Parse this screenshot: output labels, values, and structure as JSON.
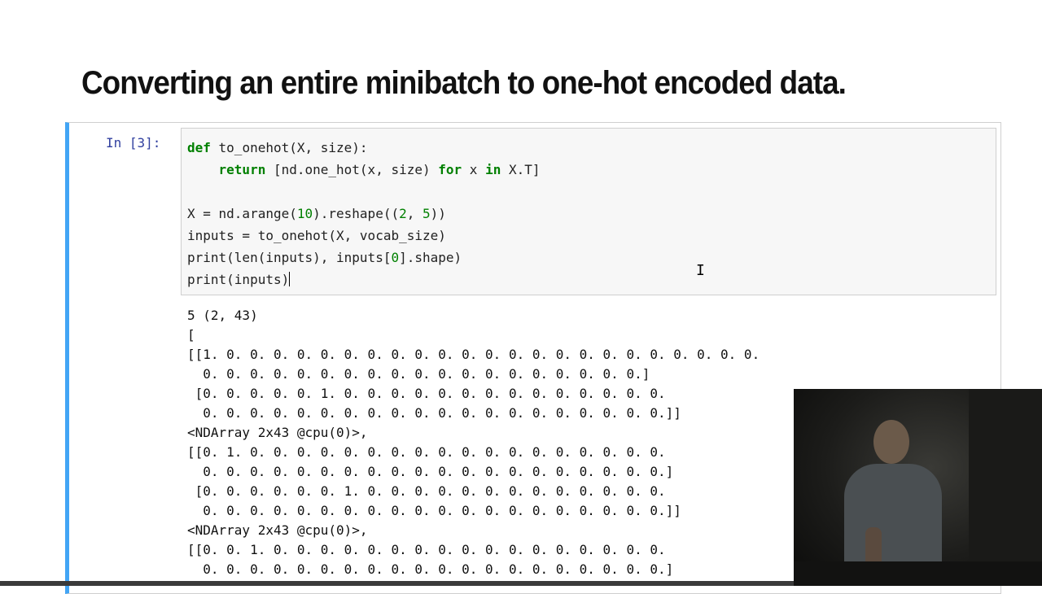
{
  "slide": {
    "heading": "Converting an entire minibatch to one-hot encoded data."
  },
  "cell": {
    "prompt": "In [3]:",
    "code_lines": [
      "def to_onehot(X, size):",
      "    return [nd.one_hot(x, size) for x in X.T]",
      "",
      "X = nd.arange(10).reshape((2, 5))",
      "inputs = to_onehot(X, vocab_size)",
      "print(len(inputs), inputs[0].shape)",
      "print(inputs)"
    ],
    "output_lines": [
      "5 (2, 43)",
      "[",
      "[[1. 0. 0. 0. 0. 0. 0. 0. 0. 0. 0. 0. 0. 0. 0. 0. 0. 0. 0. 0. 0. 0. 0. 0.",
      "  0. 0. 0. 0. 0. 0. 0. 0. 0. 0. 0. 0. 0. 0. 0. 0. 0. 0. 0.]",
      " [0. 0. 0. 0. 0. 1. 0. 0. 0. 0. 0. 0. 0. 0. 0. 0. 0. 0. 0. 0.",
      "  0. 0. 0. 0. 0. 0. 0. 0. 0. 0. 0. 0. 0. 0. 0. 0. 0. 0. 0. 0.]]",
      "<NDArray 2x43 @cpu(0)>,",
      "[[0. 1. 0. 0. 0. 0. 0. 0. 0. 0. 0. 0. 0. 0. 0. 0. 0. 0. 0. 0.",
      "  0. 0. 0. 0. 0. 0. 0. 0. 0. 0. 0. 0. 0. 0. 0. 0. 0. 0. 0. 0.]",
      " [0. 0. 0. 0. 0. 0. 1. 0. 0. 0. 0. 0. 0. 0. 0. 0. 0. 0. 0. 0.",
      "  0. 0. 0. 0. 0. 0. 0. 0. 0. 0. 0. 0. 0. 0. 0. 0. 0. 0. 0. 0.]]",
      "<NDArray 2x43 @cpu(0)>,",
      "[[0. 0. 1. 0. 0. 0. 0. 0. 0. 0. 0. 0. 0. 0. 0. 0. 0. 0. 0. 0.",
      "  0. 0. 0. 0. 0. 0. 0. 0. 0. 0. 0. 0. 0. 0. 0. 0. 0. 0. 0. 0.]"
    ]
  }
}
